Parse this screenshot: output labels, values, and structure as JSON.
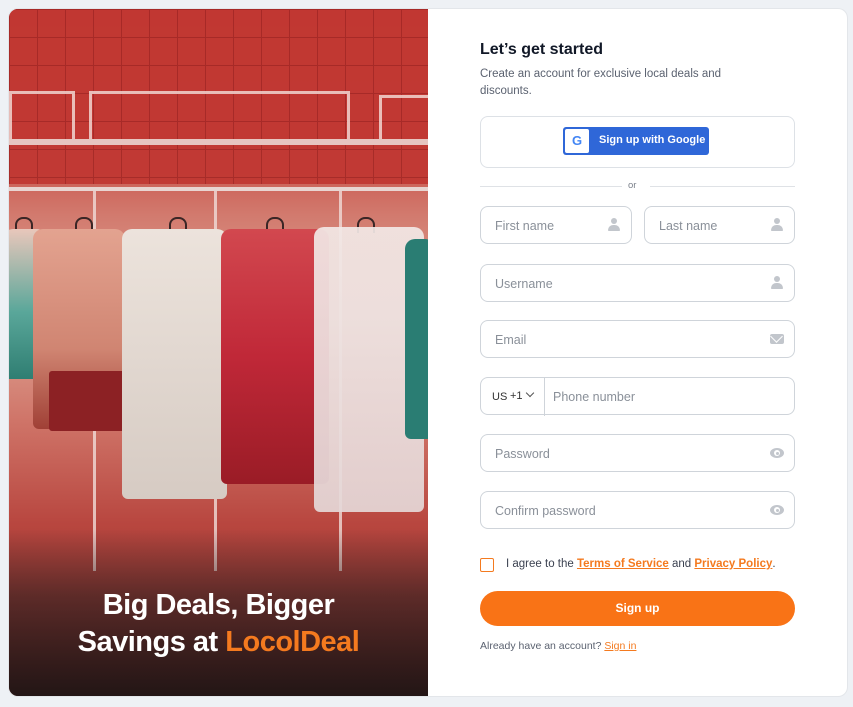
{
  "hero": {
    "headline_line1": "Big Deals, Bigger",
    "headline_prefix": "Savings at ",
    "brand_name": "LocolDeal",
    "brand_color": "#f47a1f"
  },
  "form": {
    "title": "Let’s get started",
    "subtitle": "Create an account for exclusive local deals and discounts.",
    "google_button_label": "Sign up with Google",
    "google_icon_letter": "G",
    "divider_text": "or",
    "first_name_placeholder": "First name",
    "last_name_placeholder": "Last name",
    "username_placeholder": "Username",
    "email_placeholder": "Email",
    "phone": {
      "country_code": "US",
      "dial_code": "+1",
      "placeholder": "Phone number"
    },
    "password_placeholder": "Password",
    "confirm_password_placeholder": "Confirm password",
    "agree_prefix": "I agree to the ",
    "terms_link": "Terms of Service",
    "agree_and": " and ",
    "privacy_link": "Privacy Policy",
    "agree_suffix": ".",
    "submit_label": "Sign up",
    "already_text": "Already have an account? ",
    "signin_link": "Sign in"
  },
  "colors": {
    "accent": "#f97316",
    "google_blue": "#2f67d8"
  }
}
